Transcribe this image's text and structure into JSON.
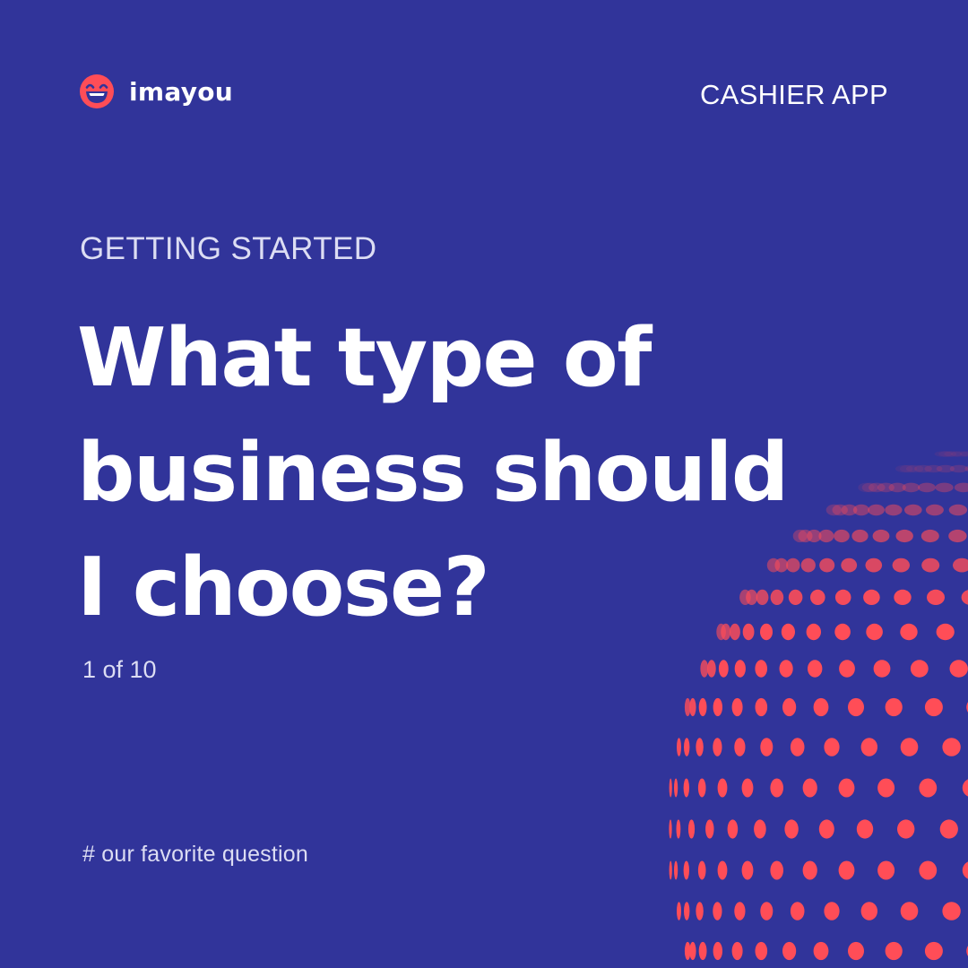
{
  "brand": {
    "name": "imayou",
    "logo_icon": "smiling-face-icon",
    "logo_color": "#FF4D57"
  },
  "header": {
    "app_label": "CASHIER APP"
  },
  "content": {
    "kicker": "GETTING STARTED",
    "headline_lines": [
      "What type of",
      "business should",
      "I choose?"
    ],
    "pager": "1 of 10",
    "hashtag": "# our favorite question"
  },
  "colors": {
    "background": "#31349A",
    "accent": "#FF4D57",
    "text": "#FFFFFF",
    "muted_text": "#DCDDF3"
  },
  "decoration": {
    "icon": "dotted-sphere-icon"
  }
}
